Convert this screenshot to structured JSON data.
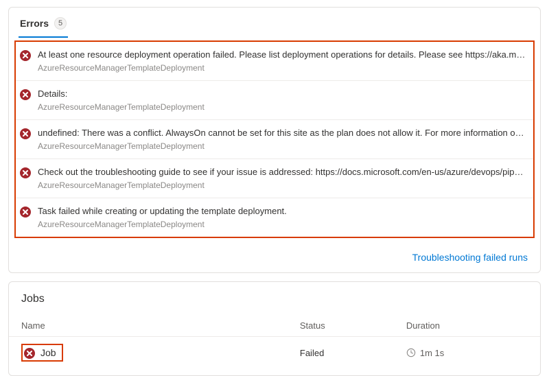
{
  "tabs": {
    "errors_label": "Errors",
    "errors_count": "5"
  },
  "errors": [
    {
      "message": "At least one resource deployment operation failed. Please list deployment operations for details. Please see https://aka.ms/DeployOper...",
      "source": "AzureResourceManagerTemplateDeployment"
    },
    {
      "message": "Details:",
      "source": "AzureResourceManagerTemplateDeployment"
    },
    {
      "message": "undefined: There was a conflict. AlwaysOn cannot be set for this site as the plan does not allow it. For more information on pricing and f...",
      "source": "AzureResourceManagerTemplateDeployment"
    },
    {
      "message": "Check out the troubleshooting guide to see if your issue is addressed: https://docs.microsoft.com/en-us/azure/devops/pipelines/tasks/...",
      "source": "AzureResourceManagerTemplateDeployment"
    },
    {
      "message": "Task failed while creating or updating the template deployment.",
      "source": "AzureResourceManagerTemplateDeployment"
    }
  ],
  "links": {
    "troubleshoot": "Troubleshooting failed runs"
  },
  "jobs": {
    "title": "Jobs",
    "headers": {
      "name": "Name",
      "status": "Status",
      "duration": "Duration"
    },
    "rows": [
      {
        "name": "Job",
        "status": "Failed",
        "duration": "1m 1s"
      }
    ]
  }
}
